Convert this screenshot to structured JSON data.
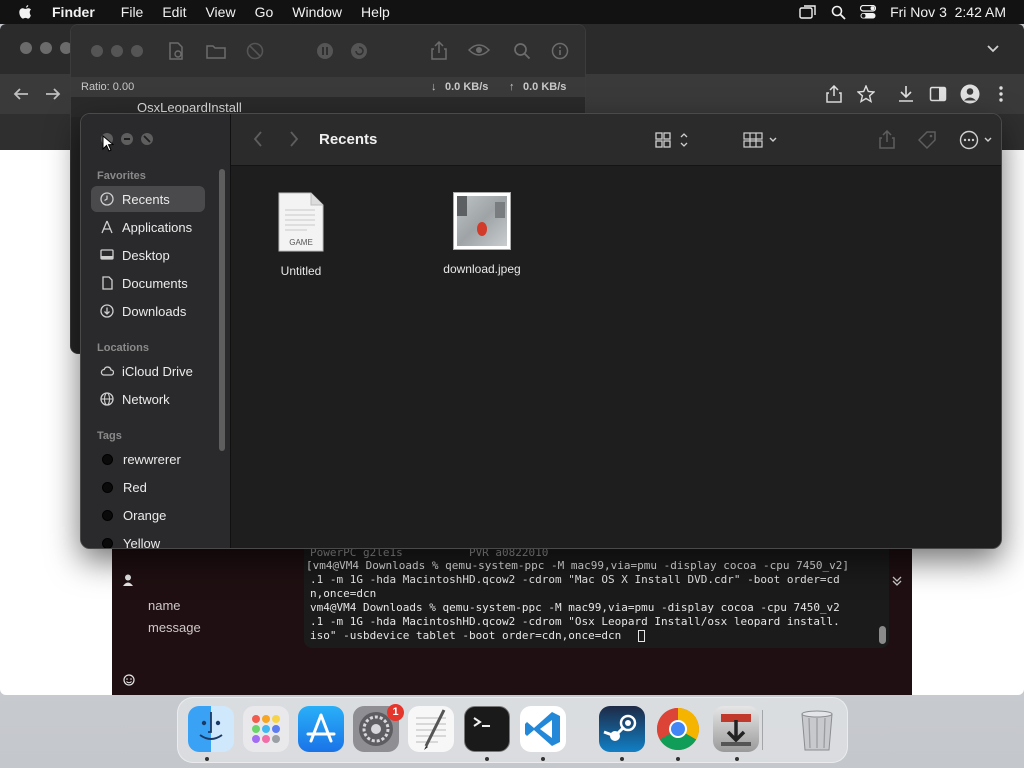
{
  "menubar": {
    "app_name": "Finder",
    "items": [
      "File",
      "Edit",
      "View",
      "Go",
      "Window",
      "Help"
    ],
    "datetime": "Fri Nov 3  2:42 AM"
  },
  "torrent_window": {
    "ratio": "Ratio: 0.00",
    "download_rate": "0.0 KB/s",
    "upload_rate": "0.0 KB/s",
    "row_name": "OsxLeopardInstall"
  },
  "finder": {
    "title": "Recents",
    "sidebar": {
      "favorites_header": "Favorites",
      "favorites": [
        {
          "label": "Recents",
          "icon": "clock-icon",
          "selected": true
        },
        {
          "label": "Applications",
          "icon": "applications-icon"
        },
        {
          "label": "Desktop",
          "icon": "desktop-icon"
        },
        {
          "label": "Documents",
          "icon": "document-icon"
        },
        {
          "label": "Downloads",
          "icon": "download-icon"
        }
      ],
      "locations_header": "Locations",
      "locations": [
        {
          "label": "iCloud Drive",
          "icon": "cloud-icon"
        },
        {
          "label": "Network",
          "icon": "globe-icon"
        }
      ],
      "tags_header": "Tags",
      "tags": [
        {
          "label": "rewwrerer",
          "color": "#0a0a0a"
        },
        {
          "label": "Red",
          "color": "#0a0a0a"
        },
        {
          "label": "Orange",
          "color": "#0a0a0a"
        },
        {
          "label": "Yellow",
          "color": "#0a0a0a"
        }
      ]
    },
    "files": [
      {
        "name": "Untitled",
        "badge": "GAME",
        "type": "document"
      },
      {
        "name": "download.jpeg",
        "type": "image"
      }
    ]
  },
  "terminal": {
    "lines": [
      "PowerPC g2le1s          PVR a0822010",
      "[vm4@VM4 Downloads % qemu-system-ppc -M mac99,via=pmu -display cocoa -cpu 7450_v2]",
      ".1 -m 1G -hda MacintoshHD.qcow2 -cdrom \"Mac OS X Install DVD.cdr\" -boot order=cd",
      "n,once=dcn",
      "vm4@VM4 Downloads % qemu-system-ppc -M mac99,via=pmu -display cocoa -cpu 7450_v2",
      ".1 -m 1G -hda MacintoshHD.qcow2 -cdrom \"Osx Leopard Install/osx leopard install.",
      "iso\" -usbdevice tablet -boot order=cdn,once=dcn"
    ]
  },
  "chat_app": {
    "name_label": "name",
    "message_label": "message"
  },
  "dock": {
    "apps": [
      "Finder",
      "Launchpad",
      "App Store",
      "System Settings",
      "TextEdit",
      "Terminal",
      "Visual Studio Code",
      "Steam",
      "Google Chrome",
      "Downloads",
      "Trash"
    ],
    "settings_badge": "1"
  },
  "colors": {
    "menubar": "#121212",
    "finder_bg": "#1e1e1e",
    "sidebar_bg": "#2a2a2c",
    "selection": "#4a4a4c",
    "badge": "#e5362c"
  }
}
